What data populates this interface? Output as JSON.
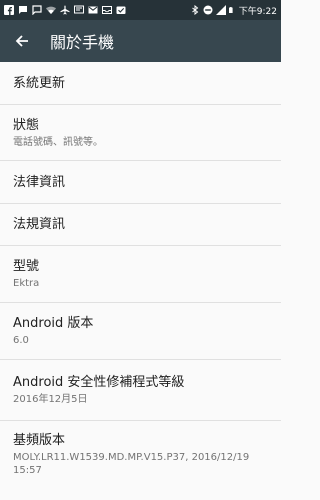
{
  "status_bar": {
    "time": "下午9:22",
    "left_icons": [
      "facebook-icon",
      "chat-icon",
      "message-icon",
      "wifi-icon",
      "airplane-icon",
      "sms-icon",
      "gmail-icon",
      "inbox-icon",
      "check-icon"
    ],
    "right_icons": [
      "bluetooth-icon",
      "do-not-disturb-icon",
      "signal-icon",
      "battery-icon"
    ]
  },
  "app_bar": {
    "title": "關於手機",
    "back_icon": "arrow-left-icon"
  },
  "items": [
    {
      "title": "系統更新"
    },
    {
      "title": "狀態",
      "subtitle": "電話號碼、訊號等。"
    },
    {
      "title": "法律資訊"
    },
    {
      "title": "法規資訊"
    },
    {
      "title": "型號",
      "subtitle": "Ektra"
    },
    {
      "title": "Android 版本",
      "subtitle": "6.0"
    },
    {
      "title": "Android 安全性修補程式等級",
      "subtitle": "2016年12月5日"
    },
    {
      "title": "基頻版本",
      "subtitle": "MOLY.LR11.W1539.MD.MP.V15.P37, 2016/12/19 15:57"
    }
  ],
  "colors": {
    "status_bar": "#263238",
    "app_bar": "#37474f",
    "background": "#fafafa",
    "divider": "#e0e0e0"
  }
}
